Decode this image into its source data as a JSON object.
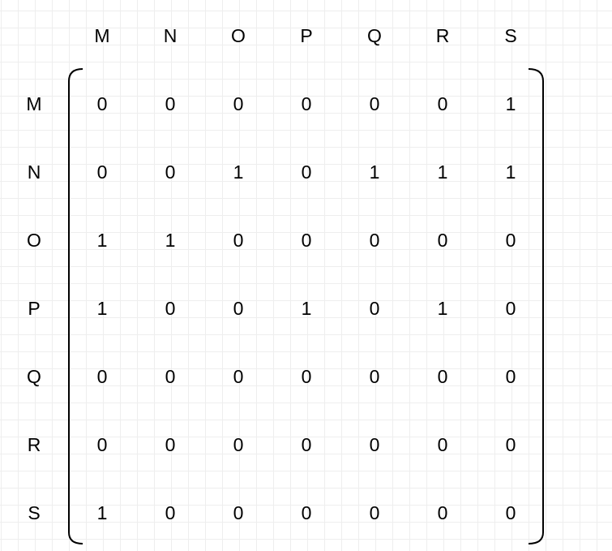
{
  "column_headers": [
    "M",
    "N",
    "O",
    "P",
    "Q",
    "R",
    "S"
  ],
  "row_headers": [
    "M",
    "N",
    "O",
    "P",
    "Q",
    "R",
    "S"
  ],
  "matrix": [
    [
      "0",
      "0",
      "0",
      "0",
      "0",
      "0",
      "1"
    ],
    [
      "0",
      "0",
      "1",
      "0",
      "1",
      "1",
      "1"
    ],
    [
      "1",
      "1",
      "0",
      "0",
      "0",
      "0",
      "0"
    ],
    [
      "1",
      "0",
      "0",
      "1",
      "0",
      "1",
      "0"
    ],
    [
      "0",
      "0",
      "0",
      "0",
      "0",
      "0",
      "0"
    ],
    [
      "0",
      "0",
      "0",
      "0",
      "0",
      "0",
      "0"
    ],
    [
      "1",
      "0",
      "0",
      "0",
      "0",
      "0",
      "0"
    ]
  ],
  "colors": {
    "background": "#ffffff",
    "grid": "#eeeeee",
    "ink": "#000000"
  }
}
